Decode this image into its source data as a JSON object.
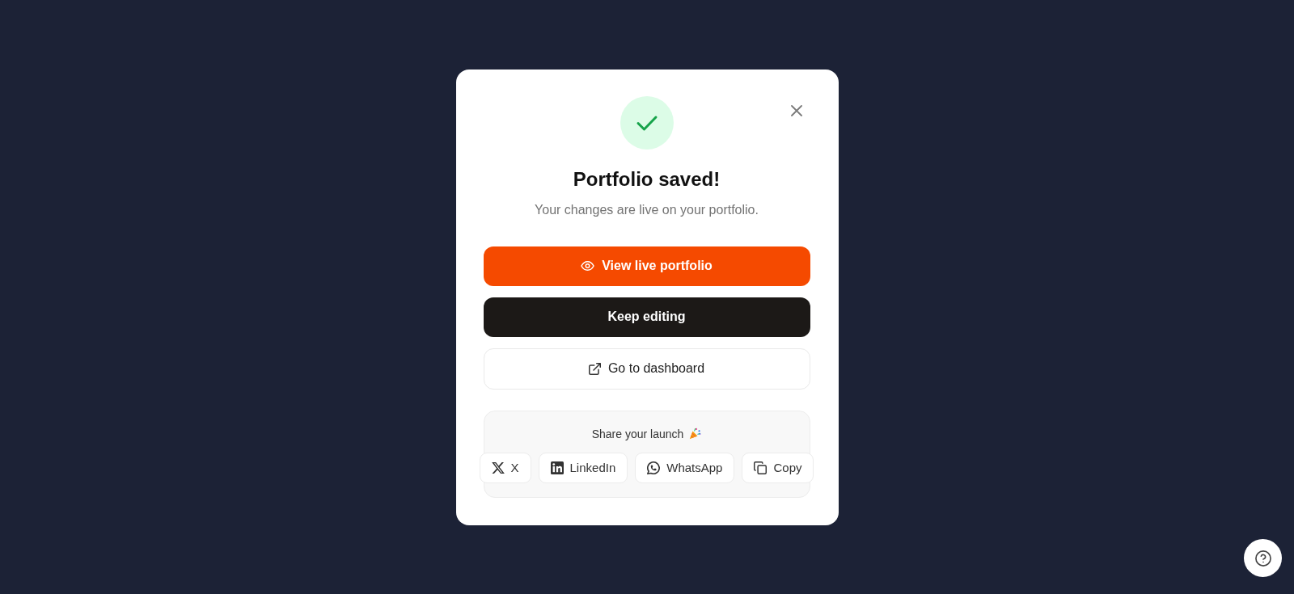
{
  "dialog": {
    "title": "Portfolio saved!",
    "message": "Your changes are live on your portfolio."
  },
  "actions": [
    {
      "label": "View live portfolio",
      "kind": "primary"
    },
    {
      "label": "Keep editing",
      "kind": "dark"
    },
    {
      "label": "Go to dashboard",
      "kind": "outline"
    }
  ],
  "share": {
    "title": "Share your launch",
    "buttons": [
      {
        "label": "X",
        "kind": "x"
      },
      {
        "label": "LinkedIn",
        "kind": "linkedin"
      },
      {
        "label": "WhatsApp",
        "kind": "whatsapp"
      },
      {
        "label": "Copy",
        "kind": "copy"
      }
    ]
  }
}
